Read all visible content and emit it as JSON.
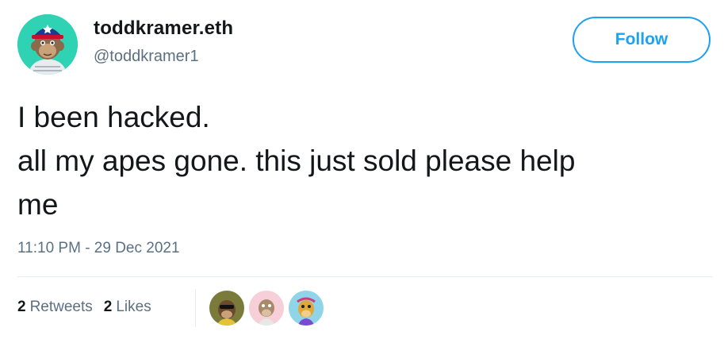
{
  "user": {
    "display_name": "toddkramer.eth",
    "handle": "@toddkramer1",
    "avatar_icon": "ape-avatar-icon"
  },
  "follow_button": {
    "label": "Follow"
  },
  "tweet": {
    "lines": [
      "I been hacked.",
      "all my apes gone. this just sold please help",
      "me"
    ],
    "timestamp": "11:10 PM - 29 Dec 2021"
  },
  "engagement": {
    "retweets": {
      "count": "2",
      "label": "Retweets"
    },
    "likes": {
      "count": "2",
      "label": "Likes"
    },
    "liker_avatars": [
      "ape-avatar-olive-icon",
      "ape-avatar-pink-icon",
      "ape-avatar-blue-icon"
    ]
  },
  "colors": {
    "accent": "#1da1f2",
    "text_primary": "#14171a",
    "text_secondary": "#5b7083",
    "avatar_bg": "#2fd3b4"
  }
}
